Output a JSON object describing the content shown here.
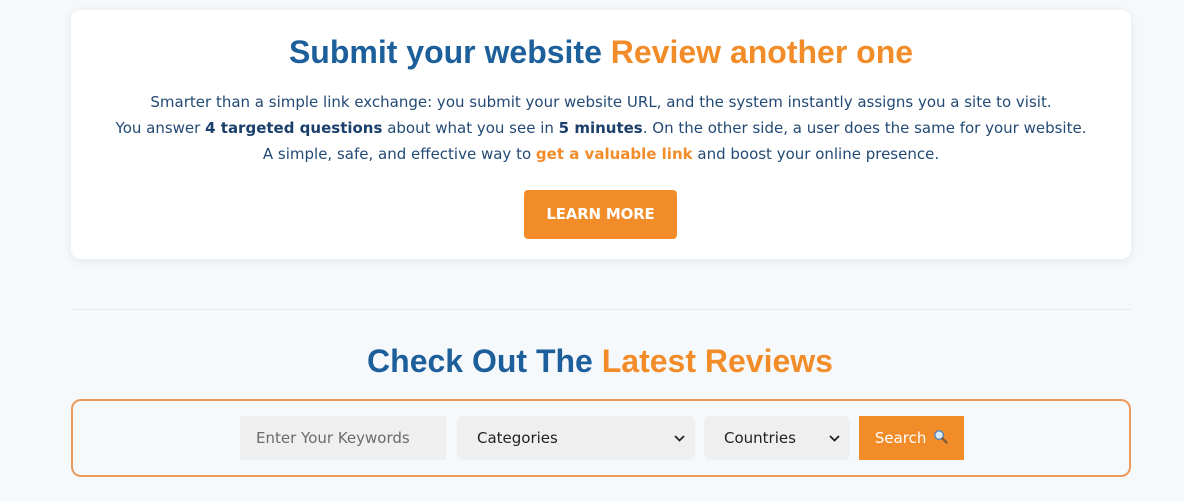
{
  "colors": {
    "brand_blue": "#1d5f9b",
    "brand_orange": "#f28c28",
    "page_bg": "#f6f9fb"
  },
  "hero": {
    "title_part1": "Submit your website",
    "title_part2": "Review another one",
    "line1": "Smarter than a simple link exchange: you submit your website URL, and the system instantly assigns you a site to visit.",
    "line2_a": "You answer ",
    "line2_b": "4 targeted questions",
    "line2_c": " about what you see in ",
    "line2_d": "5 minutes",
    "line2_e": ". On the other side, a user does the same for your website.",
    "line3_a": "A simple, safe, and effective way to ",
    "line3_b": "get a valuable link",
    "line3_c": " and boost your online presence.",
    "button_label": "LEARN MORE"
  },
  "reviews": {
    "title_part1": "Check Out The",
    "title_part2": "Latest Reviews"
  },
  "search": {
    "keyword_placeholder": "Enter Your Keywords",
    "keyword_value": "",
    "categories_selected": "Categories",
    "countries_selected": "Countries",
    "button_label": "Search",
    "button_icon": "magnifier-icon"
  }
}
